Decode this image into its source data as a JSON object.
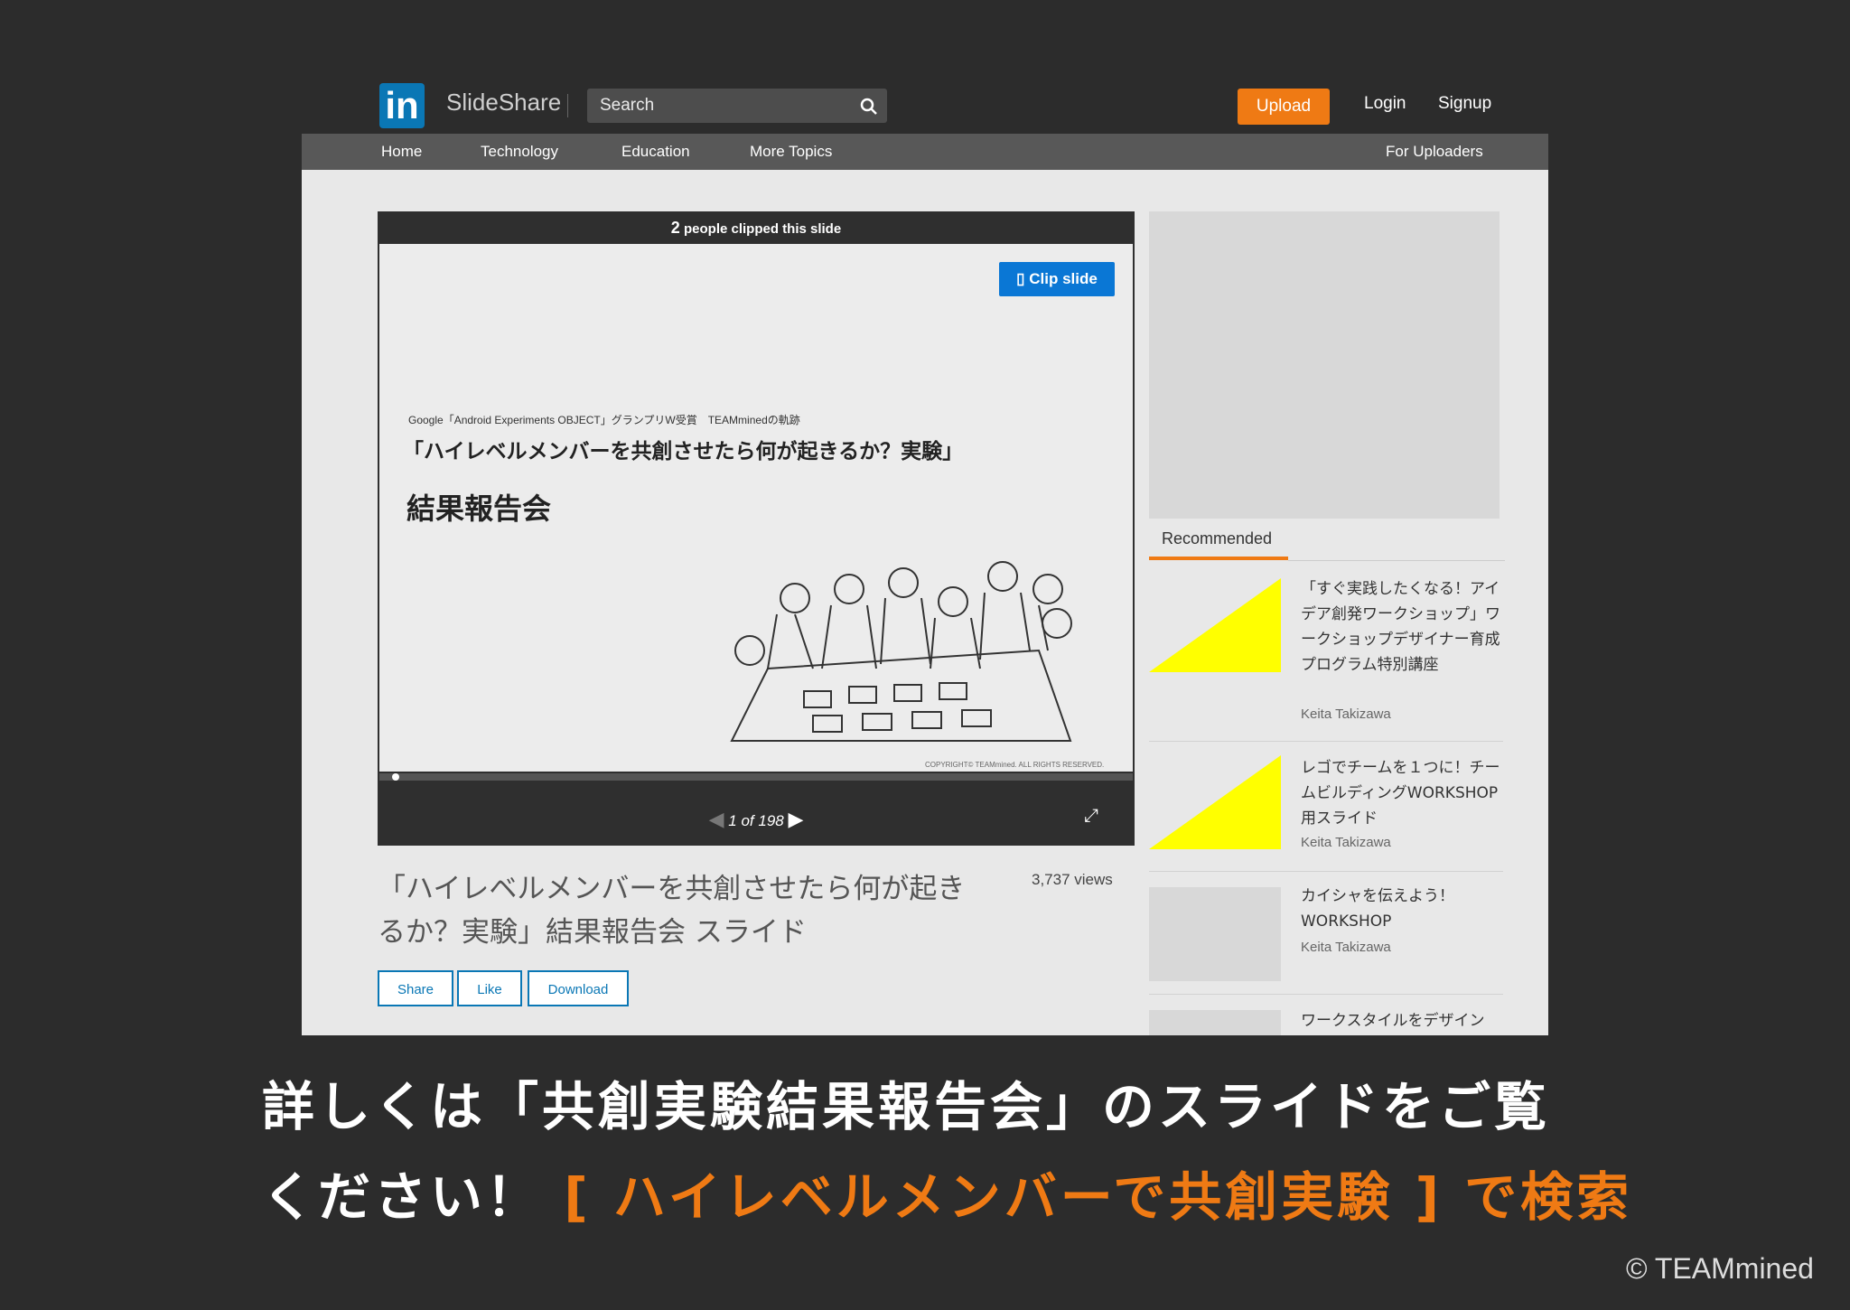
{
  "header": {
    "brand": "SlideShare",
    "search_placeholder": "Search",
    "upload_label": "Upload",
    "login_label": "Login",
    "signup_label": "Signup"
  },
  "nav": {
    "items": [
      "Home",
      "Technology",
      "Education",
      "More Topics"
    ],
    "right": "For Uploaders"
  },
  "player": {
    "clip_count": "2",
    "clip_text": "people clipped this slide",
    "clip_button": "Clip slide",
    "slide_subtitle": "Google「Android Experiments OBJECT」グランプリW受賞　TEAMminedの軌跡",
    "slide_title": "「ハイレベルメンバーを共創させたら何が起きるか？実験」",
    "slide_title2": "結果報告会",
    "slide_copyright": "COPYRIGHT© TEAMmined. ALL RIGHTS RESERVED.",
    "page_current": "1",
    "page_of": "of",
    "page_total": "198"
  },
  "deck": {
    "title": "「ハイレベルメンバーを共創させたら何が起きるか？実験」結果報告会 スライド",
    "views": "3,737 views",
    "actions": [
      "Share",
      "Like",
      "Download"
    ]
  },
  "sidebar": {
    "tab": "Recommended",
    "items": [
      {
        "title": "「すぐ実践したくなる！アイデア創発ワークショップ」ワークショップデザイナー育成プログラム特別講座",
        "author": "Keita Takizawa",
        "thumb_color": "#ffff00"
      },
      {
        "title": "レゴでチームを１つに！チームビルディングWORKSHOP用スライド",
        "author": "Keita Takizawa",
        "thumb_color": "#ffff00"
      },
      {
        "title": "カイシャを伝えよう！WORKSHOP",
        "author": "Keita Takizawa",
        "thumb_color": "#d8d8d8"
      },
      {
        "title": "ワークスタイルをデザイン",
        "author": "",
        "thumb_color": "#d8d8d8"
      }
    ]
  },
  "caption": {
    "line1": "詳しくは「共創実験結果報告会」のスライドをご覧",
    "line2_prefix": "ください！",
    "line2_highlight": "[ ハイレベルメンバーで共創実験 ] で検索"
  },
  "copyright": "© TEAMmined",
  "colors": {
    "accent": "#ef7a14",
    "link": "#0a77b5",
    "background": "#2c2c2c"
  }
}
